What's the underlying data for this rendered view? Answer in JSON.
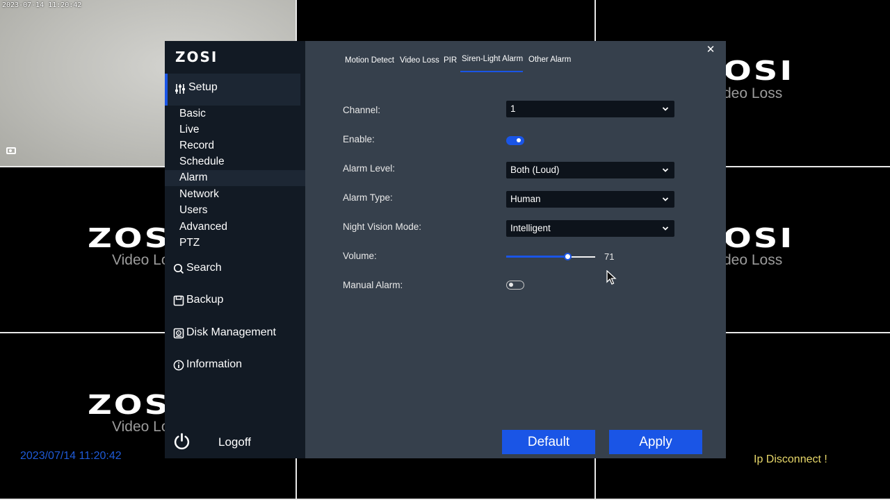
{
  "camera": {
    "timestamp": "2023-07-14 11:20:42",
    "brand_logo": "ZOSI",
    "video_loss_text": "Video Loss",
    "video_loss_text_partial": "Video Lo",
    "video_loss_text_tail": "deo Loss",
    "logo_partial": "ZOS",
    "logo_tail": "OSI"
  },
  "overlay": {
    "date_time": "2023/07/14 11:20:42",
    "ip_status": "Ip Disconnect !"
  },
  "sidebar": {
    "brand": "ZOSI",
    "setup": {
      "label": "Setup",
      "icon": "sliders-icon"
    },
    "sub_items": [
      {
        "label": "Basic"
      },
      {
        "label": "Live"
      },
      {
        "label": "Record"
      },
      {
        "label": "Schedule"
      },
      {
        "label": "Alarm",
        "active": true
      },
      {
        "label": "Network"
      },
      {
        "label": "Users"
      },
      {
        "label": "Advanced"
      },
      {
        "label": "PTZ"
      }
    ],
    "nav_items": [
      {
        "label": "Search",
        "icon": "search-icon"
      },
      {
        "label": "Backup",
        "icon": "save-icon"
      },
      {
        "label": "Disk Management",
        "icon": "disk-icon"
      },
      {
        "label": "Information",
        "icon": "info-icon"
      }
    ],
    "logoff": {
      "label": "Logoff",
      "icon": "power-icon"
    }
  },
  "tabs": [
    {
      "label": "Motion Detect"
    },
    {
      "label": "Video Loss"
    },
    {
      "label": "PIR"
    },
    {
      "label": "Siren-Light Alarm",
      "active": true
    },
    {
      "label": "Other Alarm"
    }
  ],
  "form": {
    "channel": {
      "label": "Channel:",
      "value": "1"
    },
    "enable": {
      "label": "Enable:",
      "value": true
    },
    "alarm_level": {
      "label": "Alarm Level:",
      "value": "Both (Loud)"
    },
    "alarm_type": {
      "label": "Alarm Type:",
      "value": "Human"
    },
    "night_vision": {
      "label": "Night Vision Mode:",
      "value": "Intelligent"
    },
    "volume": {
      "label": "Volume:",
      "value": "71",
      "fraction": 0.69
    },
    "manual_alarm": {
      "label": "Manual Alarm:",
      "value": false
    }
  },
  "buttons": {
    "default": "Default",
    "apply": "Apply"
  },
  "colors": {
    "accent": "#1a55e6",
    "sidebar_bg": "#121a24",
    "panel_bg": "#36404c",
    "date_overlay": "#1f5bd8",
    "ip_overlay": "#e8d86a"
  }
}
